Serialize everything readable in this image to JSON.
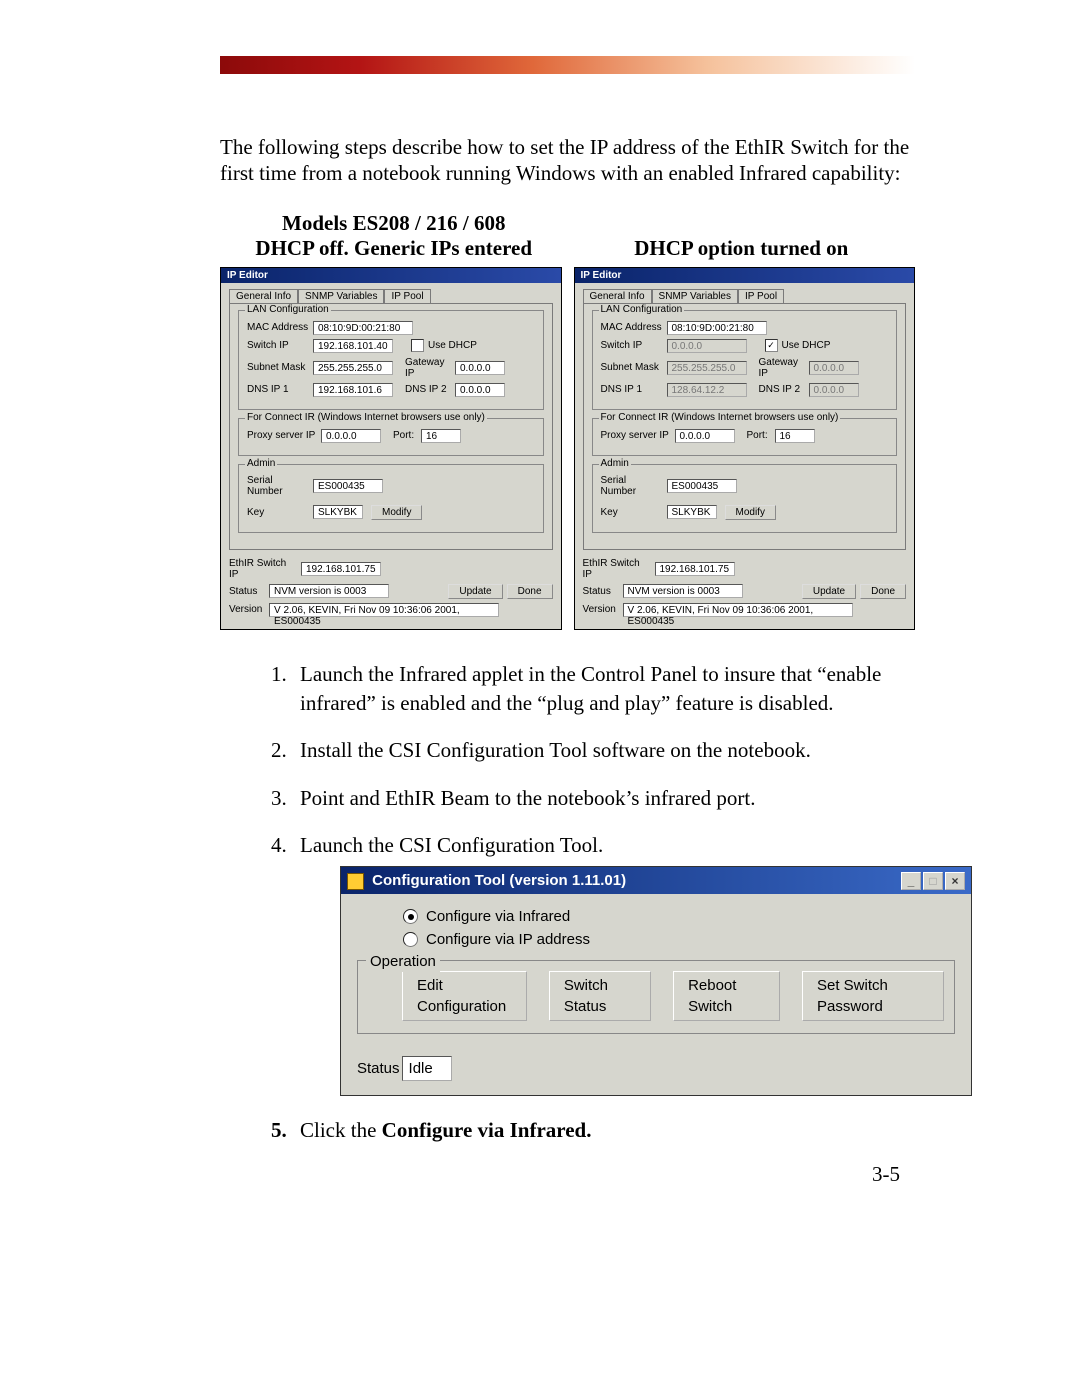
{
  "intro": "The following steps describe how to set the IP address of the EthIR Switch for the first time from a notebook running Windows with an enabled Infrared capability:",
  "captions": {
    "models": "Models ES208 / 216 / 608",
    "left": "DHCP off.  Generic IPs entered",
    "right": "DHCP option turned on"
  },
  "ip_editor": {
    "title": "IP Editor",
    "tabs": [
      "General Info",
      "SNMP Variables",
      "IP Pool"
    ],
    "groups": {
      "lan": "LAN Configuration",
      "connectir": "For Connect IR (Windows Internet browsers use only)",
      "admin": "Admin"
    },
    "labels": {
      "mac": "MAC Address",
      "switch_ip": "Switch IP",
      "use_dhcp": "Use DHCP",
      "subnet": "Subnet Mask",
      "gateway": "Gateway IP",
      "dns1": "DNS IP 1",
      "dns2": "DNS IP 2",
      "proxy": "Proxy server IP",
      "port": "Port:",
      "serial": "Serial Number",
      "key": "Key",
      "modify": "Modify",
      "ethir_switch_ip": "EthIR Switch IP",
      "status": "Status",
      "version": "Version",
      "update": "Update",
      "done": "Done"
    },
    "left": {
      "mac": "08:10:9D:00:21:80",
      "switch_ip": "192.168.101.40",
      "use_dhcp_checked": false,
      "subnet": "255.255.255.0",
      "gateway": "0.0.0.0",
      "dns1": "192.168.101.6",
      "dns2": "0.0.0.0",
      "proxy": "0.0.0.0",
      "port": "16",
      "serial": "ES000435",
      "key": "SLKYBK",
      "ethir_switch_ip": "192.168.101.75",
      "status": "NVM version is 0003",
      "version": "V 2.06, KEVIN, Fri Nov 09 10:36:06 2001, ES000435"
    },
    "right": {
      "mac": "08:10:9D:00:21:80",
      "switch_ip": "0.0.0.0",
      "use_dhcp_checked": true,
      "subnet": "255.255.255.0",
      "gateway": "0.0.0.0",
      "dns1": "128.64.12.2",
      "dns2": "0.0.0.0",
      "proxy": "0.0.0.0",
      "port": "16",
      "serial": "ES000435",
      "key": "SLKYBK",
      "ethir_switch_ip": "192.168.101.75",
      "status": "NVM version is 0003",
      "version": "V 2.06, KEVIN, Fri Nov 09 10:36:06 2001, ES000435"
    }
  },
  "steps": {
    "s1": "Launch the Infrared applet in the Control Panel to insure that “enable infrared” is enabled and the “plug and play” feature is disabled.",
    "s2": "Install the CSI Configuration Tool software on the notebook.",
    "s3": "Point and EthIR Beam to the notebook’s infrared port.",
    "s4": "Launch the CSI Configuration Tool.",
    "s5a": "Click the ",
    "s5b": "Configure via Infrared."
  },
  "config_tool": {
    "title": "Configuration Tool (version 1.11.01)",
    "radio1": "Configure via Infrared",
    "radio2": "Configure via IP address",
    "operation": "Operation",
    "buttons": {
      "edit": "Edit Configuration",
      "status": "Switch Status",
      "reboot": "Reboot Switch",
      "set_pw": "Set Switch Password"
    },
    "status_label": "Status",
    "status_value": "Idle"
  },
  "page_number": "3-5"
}
